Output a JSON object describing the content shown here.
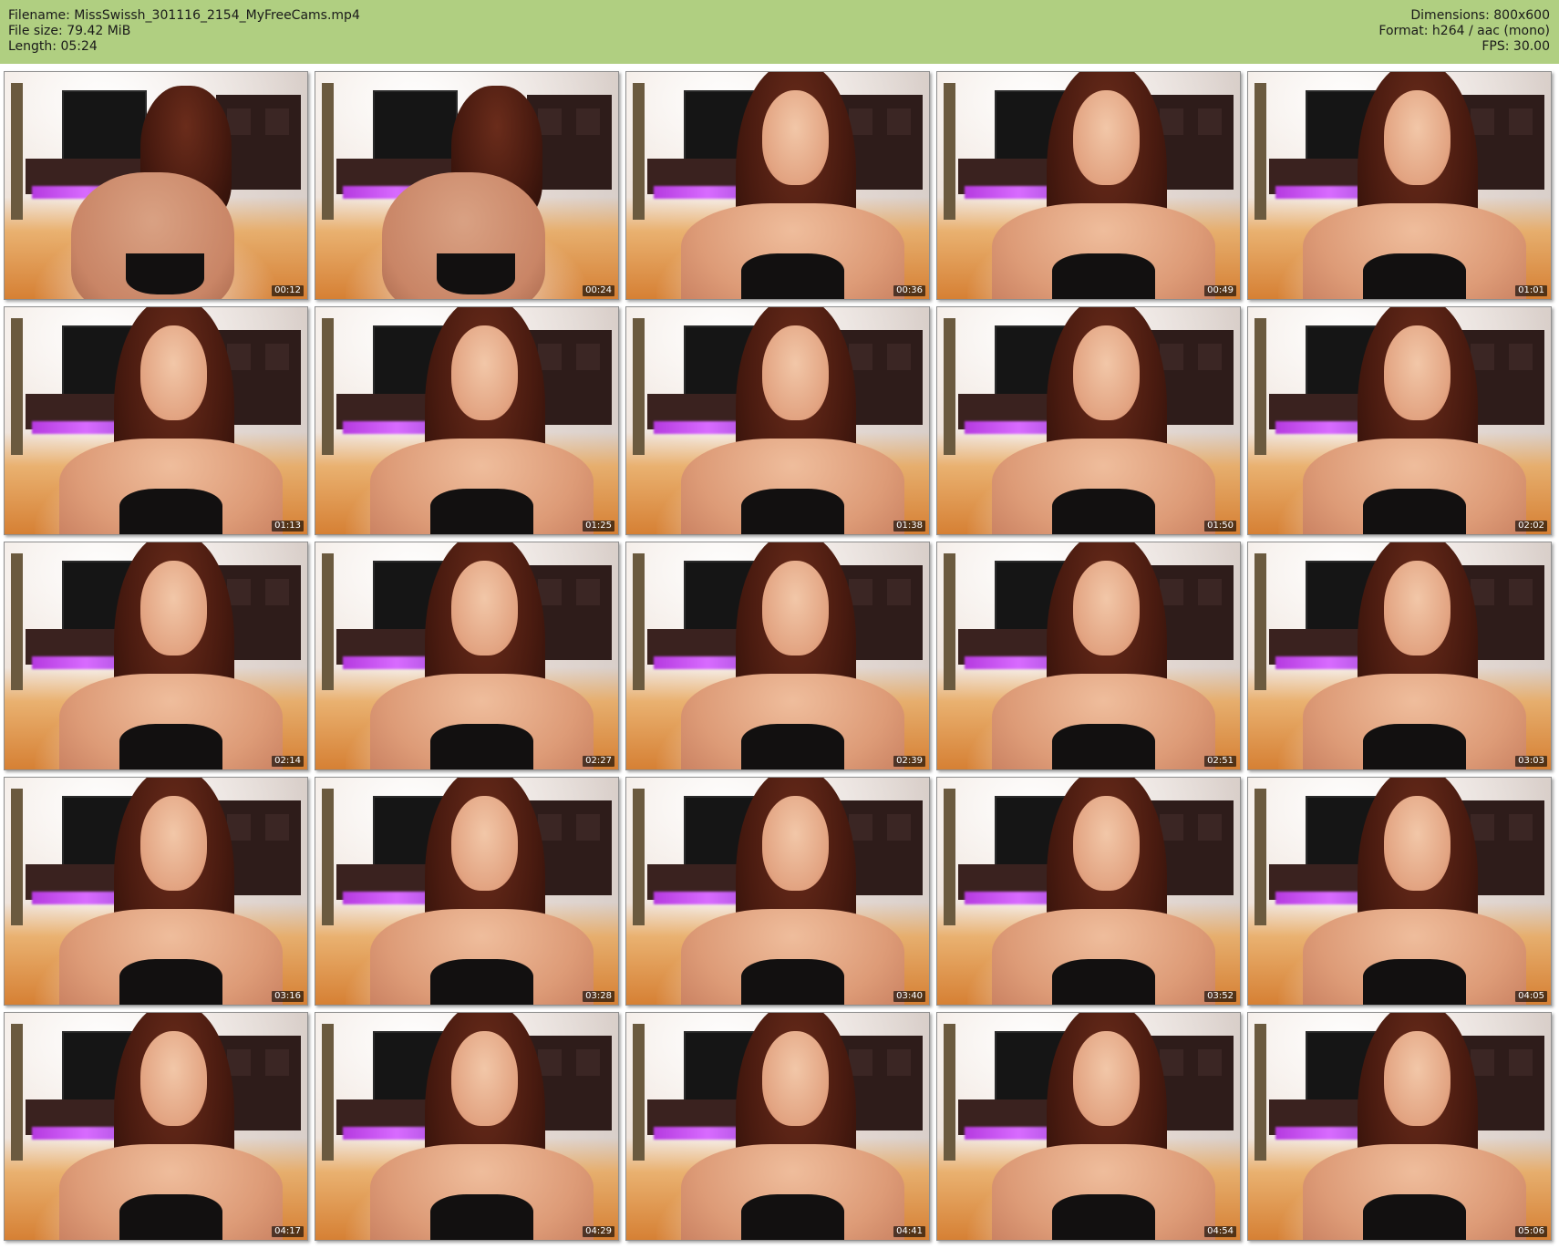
{
  "header": {
    "filename": "Filename: MissSwissh_301116_2154_MyFreeCams.mp4",
    "file_size": "File size: 79.42 MiB",
    "length": "Length: 05:24",
    "dimensions": "Dimensions: 800x600",
    "format": "Format: h264 / aac (mono)",
    "fps": "FPS: 30.00"
  },
  "colors": {
    "header_bg": "#b0cf81",
    "page_bg": "#ffffff"
  },
  "thumbnails": [
    {
      "timestamp": "00:12",
      "pose": "back"
    },
    {
      "timestamp": "00:24",
      "pose": "back"
    },
    {
      "timestamp": "00:36",
      "pose": "front"
    },
    {
      "timestamp": "00:49",
      "pose": "front"
    },
    {
      "timestamp": "01:01",
      "pose": "front"
    },
    {
      "timestamp": "01:13",
      "pose": "front"
    },
    {
      "timestamp": "01:25",
      "pose": "front"
    },
    {
      "timestamp": "01:38",
      "pose": "front"
    },
    {
      "timestamp": "01:50",
      "pose": "front"
    },
    {
      "timestamp": "02:02",
      "pose": "front"
    },
    {
      "timestamp": "02:14",
      "pose": "front"
    },
    {
      "timestamp": "02:27",
      "pose": "front"
    },
    {
      "timestamp": "02:39",
      "pose": "front"
    },
    {
      "timestamp": "02:51",
      "pose": "front"
    },
    {
      "timestamp": "03:03",
      "pose": "front"
    },
    {
      "timestamp": "03:16",
      "pose": "front"
    },
    {
      "timestamp": "03:28",
      "pose": "front"
    },
    {
      "timestamp": "03:40",
      "pose": "front"
    },
    {
      "timestamp": "03:52",
      "pose": "front"
    },
    {
      "timestamp": "04:05",
      "pose": "front"
    },
    {
      "timestamp": "04:17",
      "pose": "front"
    },
    {
      "timestamp": "04:29",
      "pose": "front"
    },
    {
      "timestamp": "04:41",
      "pose": "front"
    },
    {
      "timestamp": "04:54",
      "pose": "front"
    },
    {
      "timestamp": "05:06",
      "pose": "front"
    }
  ]
}
